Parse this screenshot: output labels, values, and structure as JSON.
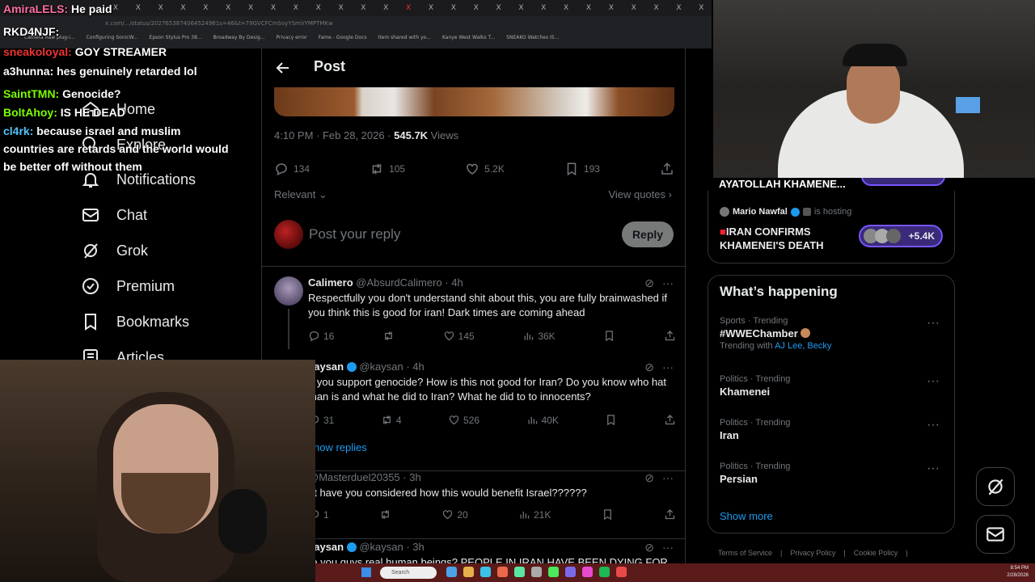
{
  "browser": {
    "tabs": [
      "X",
      "X",
      "X",
      "X",
      "X",
      "X",
      "X",
      "X",
      "X",
      "X",
      "X",
      "X",
      "X",
      "X",
      "X",
      "X",
      "X",
      "X",
      "X",
      "X",
      "X",
      "X",
      "X",
      "X",
      "X",
      "X",
      "X"
    ],
    "url": "x.com/.../status/2027653874064524961s=46&t=79GVCFCmSoyYSmVYMPTMKw",
    "bookmarks": [
      "Camera Raw plug-i...",
      "Configuring SonicW...",
      "Epson Stylus Pro 38...",
      "Broadway By Desig...",
      "Privacy error",
      "Fame - Google Docs",
      "Item shared with yo...",
      "Kanye West Walks T...",
      "SNEAKO Watches IS..."
    ]
  },
  "chat": [
    {
      "user": "AmiraLELS:",
      "msg": "He paid",
      "color": "#ff6fa8"
    },
    {
      "user": "RKD4NJF:",
      "msg": "",
      "color": "#ffffff"
    },
    {
      "user": "sneakoloyal:",
      "msg": "GOY STREAMER",
      "color": "#e33"
    },
    {
      "user": "a3hunna:",
      "msg": "hes genuinely retarded lol",
      "color": "#ffffff"
    },
    {
      "user": "SaintTMN:",
      "msg": "Genocide?",
      "color": "#7cfc00"
    },
    {
      "user": "BoltAhoy:",
      "msg": "IS HE DEAD",
      "color": "#7cfc00"
    },
    {
      "user": "cl4rk:",
      "msg": "because israel and muslim",
      "color": "#4fc3f7"
    },
    {
      "user": "",
      "msg": "countries are retards and the world would",
      "color": "#fff"
    },
    {
      "user": "",
      "msg": "be better off without them",
      "color": "#fff"
    }
  ],
  "nav": {
    "home": "Home",
    "explore": "Explore",
    "notifications": "Notifications",
    "chat": "Chat",
    "grok": "Grok",
    "premium": "Premium",
    "bookmarks": "Bookmarks",
    "articles": "Articles"
  },
  "post": {
    "title": "Post",
    "time": "4:10 PM · Feb 28, 2026 · ",
    "views": "545.7K",
    "views_label": " Views",
    "replies": "134",
    "reposts": "105",
    "likes": "5.2K",
    "bookmarks": "193",
    "sort": "Relevant",
    "view_quotes": "View quotes",
    "reply_placeholder": "Post your reply",
    "reply_button": "Reply"
  },
  "replies": [
    {
      "name": "Calimero",
      "handle": "@AbsurdCalimero · 4h",
      "text": "Respectfully you don't understand shit about this, you are fully brainwashed if you think this is good for iran! Dark times are coming ahead",
      "replies": "16",
      "reposts": "",
      "likes": "145",
      "views": "36K"
    },
    {
      "name": "kaysan",
      "handle": "@kaysan · 4h",
      "text": "o you support genocide? How is this not good for Iran? Do you know who hat man is and what he did to Iran? What he did to to innocents?",
      "replies": "31",
      "reposts": "4",
      "likes": "526",
      "views": "40K"
    },
    {
      "name": "",
      "handle": "@Masterduel20355 · 3h",
      "text": "ut have you considered how this would benefit Israel??????",
      "replies": "1",
      "reposts": "",
      "likes": "20",
      "views": "21K"
    },
    {
      "name": "kaysan",
      "handle": "@kaysan · 3h",
      "text": "re you guys real human beings? PEOPLE IN IRAN HAVE BEEN DYING FOR",
      "replies": "",
      "reposts": "",
      "likes": "",
      "views": ""
    }
  ],
  "show_replies": "how replies",
  "spaces": {
    "first_title": "AYATOLLAH KHAMENE...",
    "host": "Mario Nawfal",
    "host_status": "is hosting",
    "title_line1": "IRAN CONFIRMS",
    "title_line2": "KHAMENEI'S DEATH",
    "listeners": "+5.4K"
  },
  "happening": {
    "title": "What’s happening",
    "trends": [
      {
        "cat": "Sports · Trending",
        "name": "#WWEChamber",
        "with_label": "Trending with",
        "with": "AJ Lee, Becky"
      },
      {
        "cat": "Politics · Trending",
        "name": "Khamenei",
        "with_label": "",
        "with": ""
      },
      {
        "cat": "Politics · Trending",
        "name": "Iran",
        "with_label": "",
        "with": ""
      },
      {
        "cat": "Politics · Trending",
        "name": "Persian",
        "with_label": "",
        "with": ""
      }
    ],
    "show_more": "Show more"
  },
  "footer": [
    "Terms of Service",
    "|",
    "Privacy Policy",
    "|",
    "Cookie Policy",
    "|"
  ],
  "taskbar": {
    "search": "Search",
    "time": "8:54 PM",
    "date": "2/28/2026"
  }
}
